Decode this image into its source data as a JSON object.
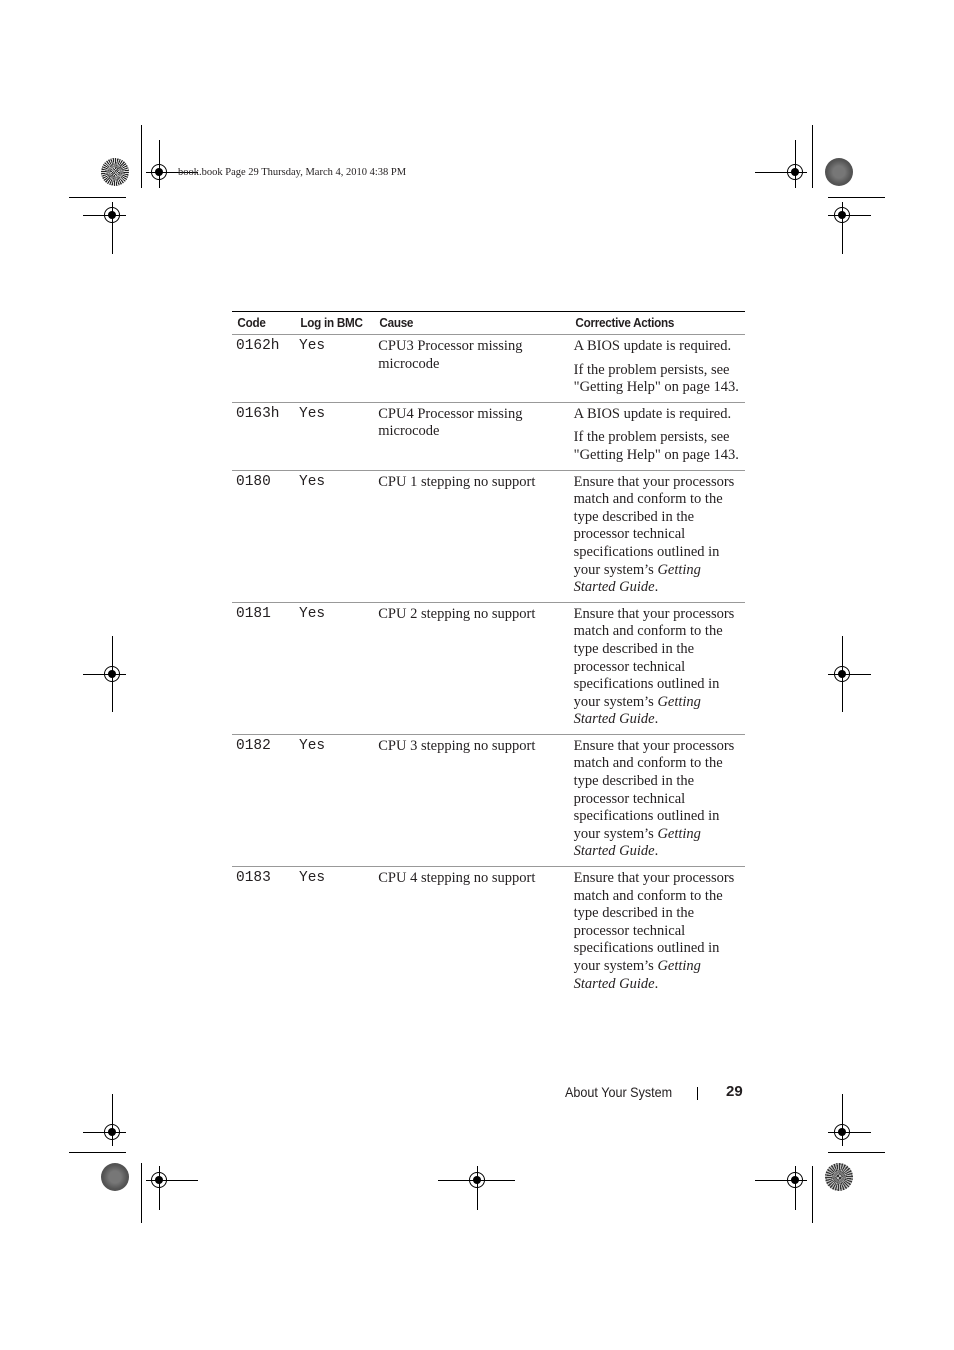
{
  "header": {
    "slug": "book.book  Page 29  Thursday, March 4, 2010  4:38 PM"
  },
  "table": {
    "columns": [
      "Code",
      "Log in BMC",
      "Cause",
      "Corrective Actions"
    ],
    "rows": [
      {
        "code": "0162h",
        "log": "Yes",
        "cause": "CPU3 Processor missing microcode",
        "actions": [
          "A BIOS update is required.",
          "If the problem persists, see \"Getting Help\" on page 143."
        ]
      },
      {
        "code": "0163h",
        "log": "Yes",
        "cause": "CPU4 Processor missing microcode",
        "actions": [
          "A BIOS update is required.",
          "If the problem persists, see \"Getting Help\" on page 143."
        ]
      },
      {
        "code": "0180",
        "log": "Yes",
        "cause": "CPU 1 stepping no support",
        "action_text": "Ensure that your processors match and conform to the type described in the processor technical specifications outlined in your system’s ",
        "action_ref": "Getting Started Guide",
        "action_end": "."
      },
      {
        "code": "0181",
        "log": "Yes",
        "cause": "CPU 2 stepping no support",
        "action_text": "Ensure that your processors match and conform to the type described in the processor technical specifications outlined in your system’s ",
        "action_ref": "Getting Started Guide",
        "action_end": "."
      },
      {
        "code": "0182",
        "log": "Yes",
        "cause": "CPU 3 stepping no support",
        "action_text": "Ensure that your processors match and conform to the type described in the processor technical specifications outlined in your system’s ",
        "action_ref": "Getting Started Guide",
        "action_end": "."
      },
      {
        "code": "0183",
        "log": "Yes",
        "cause": "CPU 4 stepping no support",
        "action_text": "Ensure that your processors match and conform to the type described in the processor technical specifications outlined in your system’s ",
        "action_ref": "Getting Started Guide",
        "action_end": "."
      }
    ]
  },
  "footer": {
    "section_title": "About Your System",
    "page_number": "29"
  },
  "icons": {
    "registration_mark": "crosshair-registration-icon",
    "color_bar": "starburst-target-icon"
  }
}
